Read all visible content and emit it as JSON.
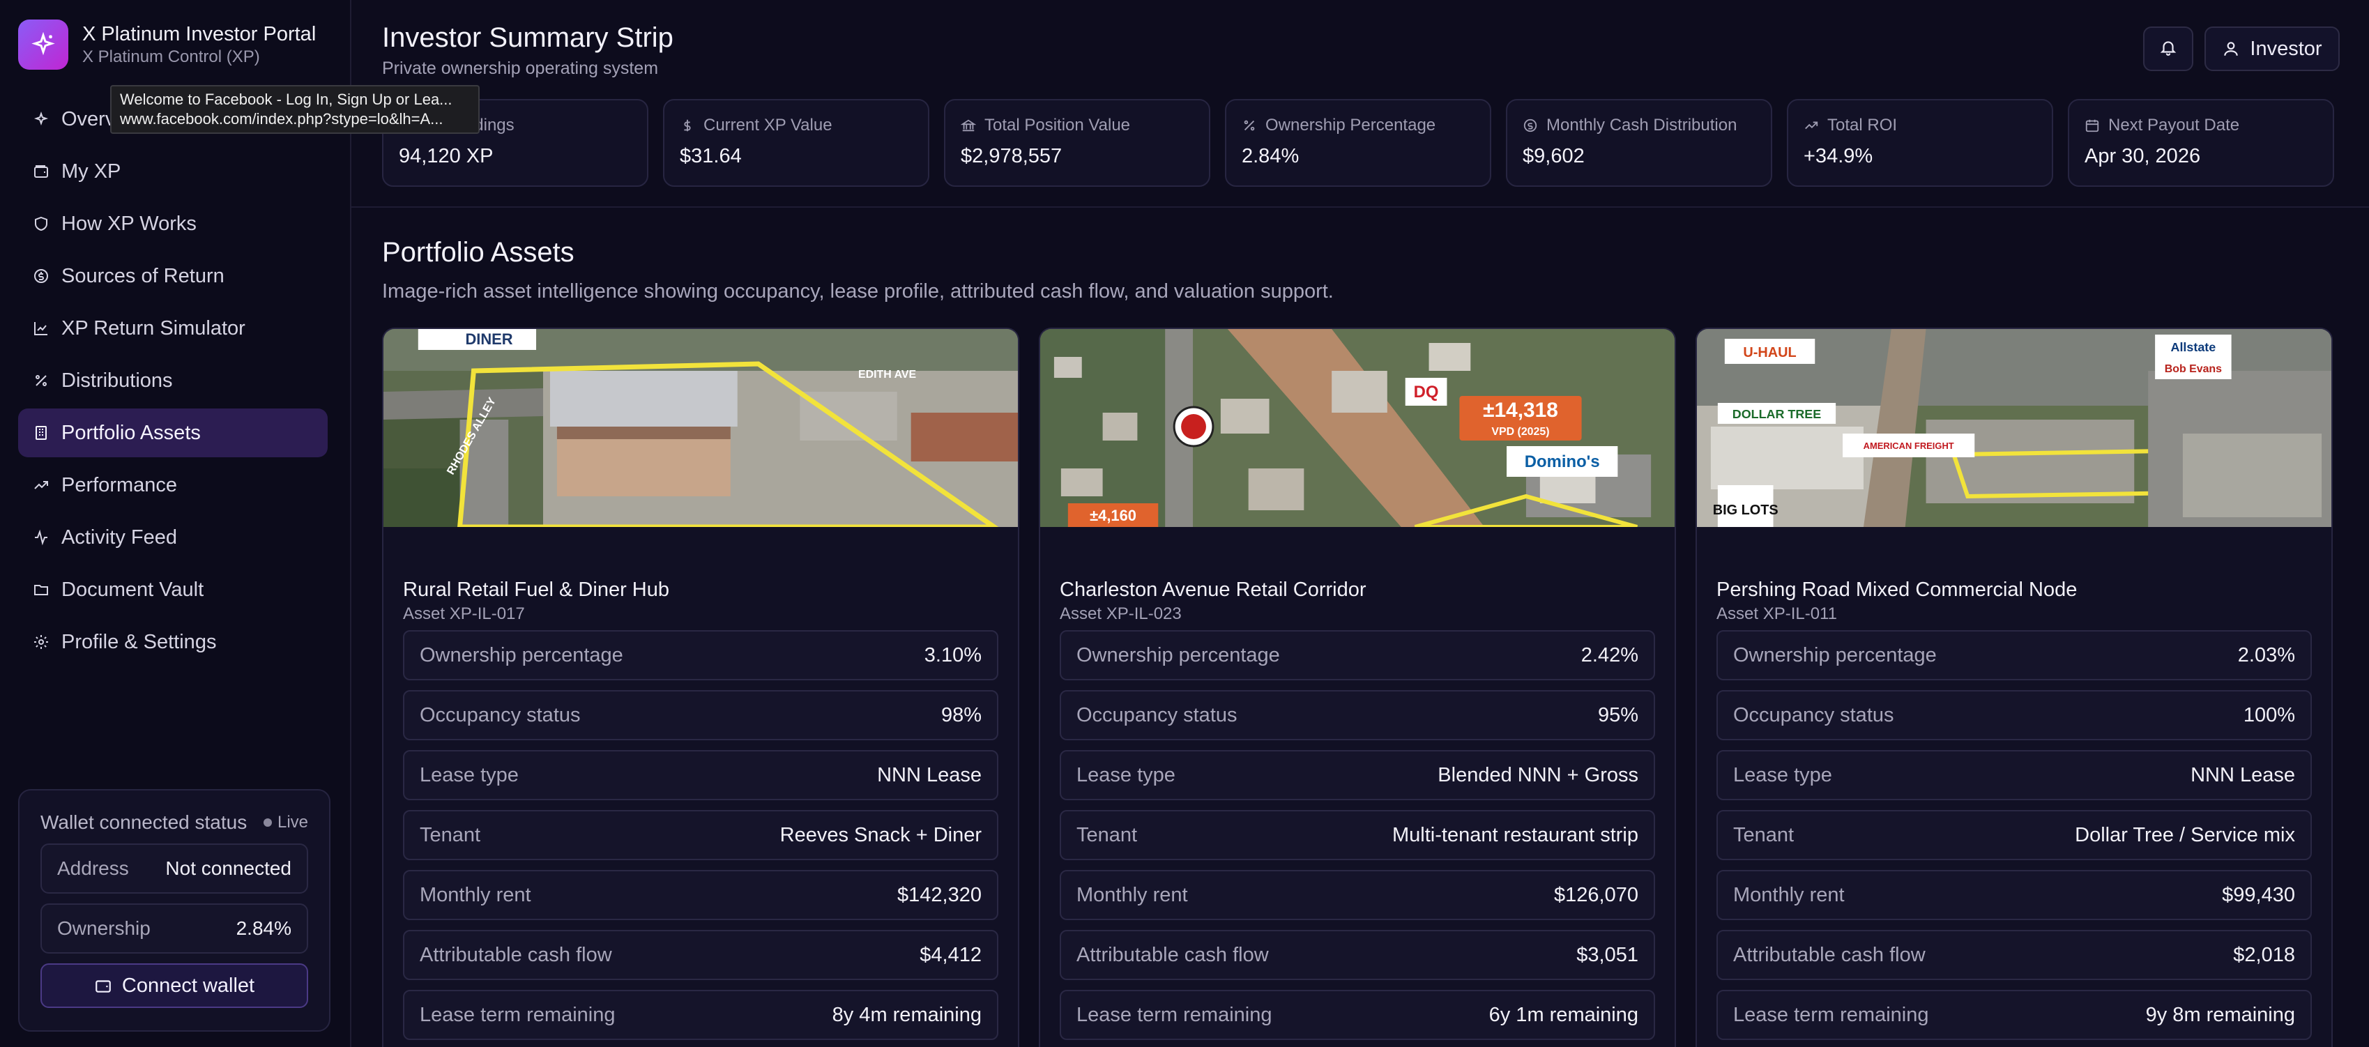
{
  "brand": {
    "title": "X Platinum Investor Portal",
    "subtitle": "X Platinum Control (XP)",
    "accent": "#8b5cf6"
  },
  "tooltip": {
    "line1": "Welcome to Facebook - Log In, Sign Up or Lea...",
    "line2": "www.facebook.com/index.php?stype=lo&lh=A..."
  },
  "sidebar": {
    "items": [
      {
        "label": "Overview",
        "icon": "sparkle-icon"
      },
      {
        "label": "My XP",
        "icon": "wallet-icon"
      },
      {
        "label": "How XP Works",
        "icon": "shield-icon"
      },
      {
        "label": "Sources of Return",
        "icon": "coin-icon"
      },
      {
        "label": "XP Return Simulator",
        "icon": "chart-icon"
      },
      {
        "label": "Distributions",
        "icon": "percent-icon"
      },
      {
        "label": "Portfolio Assets",
        "icon": "building-icon",
        "active": true
      },
      {
        "label": "Performance",
        "icon": "trend-icon"
      },
      {
        "label": "Activity Feed",
        "icon": "activity-icon"
      },
      {
        "label": "Document Vault",
        "icon": "folder-icon"
      },
      {
        "label": "Profile & Settings",
        "icon": "gear-icon"
      }
    ]
  },
  "wallet": {
    "status_label": "Wallet connected status",
    "live_label": "Live",
    "address_label": "Address",
    "address_value": "Not connected",
    "ownership_label": "Ownership",
    "ownership_value": "2.84%",
    "connect_label": "Connect wallet"
  },
  "header": {
    "title": "Investor Summary Strip",
    "subtitle": "Private ownership operating system",
    "investor_label": "Investor"
  },
  "metrics": [
    {
      "label": "XP Holdings",
      "value": "94,120 XP",
      "icon": "wallet-icon"
    },
    {
      "label": "Current XP Value",
      "value": "$31.64",
      "icon": "dollar-icon"
    },
    {
      "label": "Total Position Value",
      "value": "$2,978,557",
      "icon": "bank-icon"
    },
    {
      "label": "Ownership Percentage",
      "value": "2.84%",
      "icon": "percent-icon"
    },
    {
      "label": "Monthly Cash Distribution",
      "value": "$9,602",
      "icon": "coin-icon"
    },
    {
      "label": "Total ROI",
      "value": "+34.9%",
      "icon": "trend-icon"
    },
    {
      "label": "Next Payout Date",
      "value": "Apr 30, 2026",
      "icon": "calendar-icon"
    }
  ],
  "portfolio": {
    "title": "Portfolio Assets",
    "subtitle": "Image-rich asset intelligence showing occupancy, lease profile, attributed cash flow, and valuation support."
  },
  "assets": [
    {
      "name": "Rural Retail Fuel & Diner Hub",
      "id": "Asset XP-IL-017",
      "image_labels": {
        "diner": "DINER",
        "street": "EDITH AVE",
        "alley": "RHODES ALLEY"
      },
      "rows": [
        {
          "k": "Ownership percentage",
          "v": "3.10%"
        },
        {
          "k": "Occupancy status",
          "v": "98%"
        },
        {
          "k": "Lease type",
          "v": "NNN Lease"
        },
        {
          "k": "Tenant",
          "v": "Reeves Snack + Diner"
        },
        {
          "k": "Monthly rent",
          "v": "$142,320"
        },
        {
          "k": "Attributable cash flow",
          "v": "$4,412"
        },
        {
          "k": "Lease term remaining",
          "v": "8y 4m remaining"
        }
      ]
    },
    {
      "name": "Charleston Avenue Retail Corridor",
      "id": "Asset XP-IL-023",
      "image_labels": {
        "vpd": "±14,318",
        "vpd_sub": "VPD (2025)",
        "dq": "DQ",
        "dominos": "Domino's",
        "small": "±4,160"
      },
      "rows": [
        {
          "k": "Ownership percentage",
          "v": "2.42%"
        },
        {
          "k": "Occupancy status",
          "v": "95%"
        },
        {
          "k": "Lease type",
          "v": "Blended NNN + Gross"
        },
        {
          "k": "Tenant",
          "v": "Multi-tenant restaurant strip"
        },
        {
          "k": "Monthly rent",
          "v": "$126,070"
        },
        {
          "k": "Attributable cash flow",
          "v": "$3,051"
        },
        {
          "k": "Lease term remaining",
          "v": "6y 1m remaining"
        }
      ]
    },
    {
      "name": "Pershing Road Mixed Commercial Node",
      "id": "Asset XP-IL-011",
      "image_labels": {
        "uhaul": "U-HAUL",
        "dollar": "DOLLAR TREE",
        "biglots": "BIG LOTS",
        "allstate": "Allstate",
        "bobevans": "Bob Evans",
        "furniture": "AMERICAN FREIGHT"
      },
      "rows": [
        {
          "k": "Ownership percentage",
          "v": "2.03%"
        },
        {
          "k": "Occupancy status",
          "v": "100%"
        },
        {
          "k": "Lease type",
          "v": "NNN Lease"
        },
        {
          "k": "Tenant",
          "v": "Dollar Tree / Service mix"
        },
        {
          "k": "Monthly rent",
          "v": "$99,430"
        },
        {
          "k": "Attributable cash flow",
          "v": "$2,018"
        },
        {
          "k": "Lease term remaining",
          "v": "9y 8m remaining"
        }
      ]
    }
  ]
}
